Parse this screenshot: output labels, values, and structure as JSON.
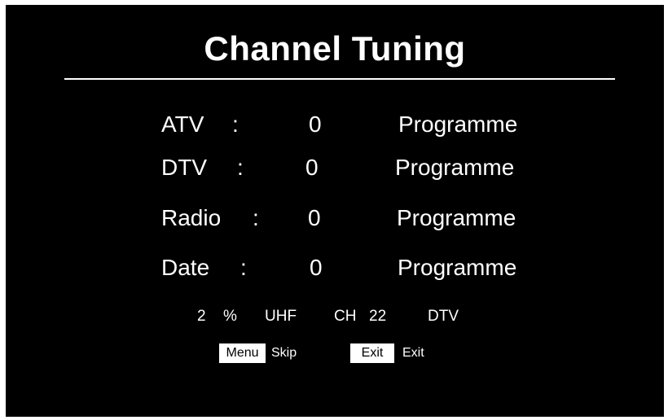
{
  "title": "Channel Tuning",
  "rows": [
    {
      "label": "ATV",
      "sep": ":",
      "count": "0",
      "unit": "Programme"
    },
    {
      "label": "DTV",
      "sep": ":",
      "count": "0",
      "unit": "Programme"
    },
    {
      "label": "Radio",
      "sep": ":",
      "count": "0",
      "unit": "Programme"
    },
    {
      "label": "Date",
      "sep": ":",
      "count": "0",
      "unit": "Programme"
    }
  ],
  "status": {
    "progress_value": "2",
    "progress_unit": "%",
    "band": "UHF",
    "channel_label": "CH",
    "channel_number": "22",
    "mode": "DTV"
  },
  "hints": {
    "menu_key": "Menu",
    "menu_action": "Skip",
    "exit_key": "Exit",
    "exit_action": "Exit"
  },
  "colors": {
    "background": "#000000",
    "text": "#ffffff",
    "badge_bg": "#ffffff",
    "badge_text": "#000000"
  }
}
